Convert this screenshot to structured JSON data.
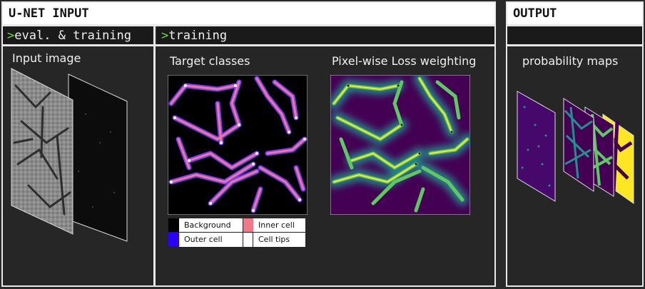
{
  "unet_input": {
    "title": "U-NET INPUT"
  },
  "output": {
    "title": "OUTPUT",
    "subtitle": "probability maps"
  },
  "tabs": {
    "eval_prefix": ">",
    "eval_label": "eval. & training",
    "train_prefix": ">",
    "train_label": "training"
  },
  "sections": {
    "input_image": "Input image",
    "target_classes": "Target classes",
    "loss_weighting": "Pixel-wise Loss weighting"
  },
  "legend": [
    {
      "label": "Background",
      "color": "#000000"
    },
    {
      "label": "Inner cell",
      "color": "#f07a8a"
    },
    {
      "label": "Outer cell",
      "color": "#2a00ff"
    },
    {
      "label": "Cell tips",
      "color": "#ffffff"
    }
  ],
  "colors": {
    "accent_green": "#6ddc3c",
    "inner_cell": "#f07a8a",
    "outer_cell": "#7a3cff",
    "viridis_low": "#440154",
    "viridis_mid": "#21918c",
    "viridis_high": "#fde725"
  }
}
